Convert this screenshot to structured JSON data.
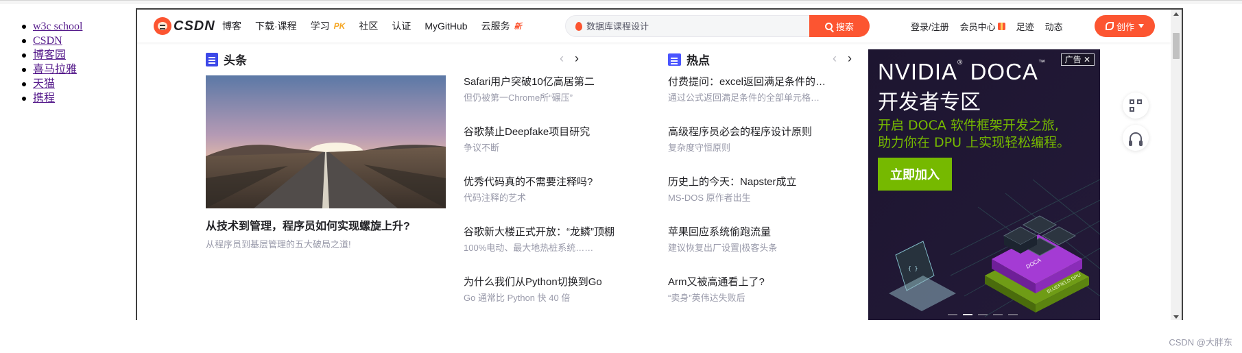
{
  "outer_links": [
    "w3c school",
    "CSDN",
    "博客园",
    "喜马拉雅",
    "天猫",
    "携程"
  ],
  "watermark": "CSDN @大胖东",
  "toolbar": {
    "logo_text": "CSDN",
    "nav": [
      {
        "label": "博客",
        "badge": ""
      },
      {
        "label": "下载·课程",
        "badge": ""
      },
      {
        "label": "学习",
        "badge": "PK"
      },
      {
        "label": "社区",
        "badge": ""
      },
      {
        "label": "认证",
        "badge": ""
      },
      {
        "label": "MyGitHub",
        "badge": ""
      },
      {
        "label": "云服务",
        "badge": "新"
      }
    ],
    "search_placeholder": "数据库课程设计",
    "search_button": "搜索",
    "right": [
      "登录/注册",
      "会员中心",
      "足迹",
      "动态"
    ],
    "create_button": "创作"
  },
  "headline": {
    "section_title": "头条",
    "hero": {
      "title": "从技术到管理，程序员如何实现螺旋上升?",
      "subtitle": "从程序员到基层管理的五大破局之道!"
    },
    "items": [
      {
        "title": "Safari用户突破10亿高居第二",
        "sub": "但仍被第一Chrome所“碾压”"
      },
      {
        "title": "谷歌禁止Deepfake项目研究",
        "sub": "争议不断"
      },
      {
        "title": "优秀代码真的不需要注释吗?",
        "sub": "代码注释的艺术"
      },
      {
        "title": "谷歌新大楼正式开放：“龙鳞”顶棚",
        "sub": "100%电动、最大地热桩系统……"
      },
      {
        "title": "为什么我们从Python切换到Go",
        "sub": "Go 通常比 Python 快 40 倍"
      }
    ]
  },
  "hot": {
    "section_title": "热点",
    "items": [
      {
        "title": "付费提问：excel返回满足条件的…",
        "sub": "通过公式返回满足条件的全部单元格…"
      },
      {
        "title": "高级程序员必会的程序设计原则",
        "sub": "复杂度守恒原则"
      },
      {
        "title": "历史上的今天：Napster成立",
        "sub": "MS-DOS 原作者出生"
      },
      {
        "title": "苹果回应系统偷跑流量",
        "sub": "建议恢复出厂设置|极客头条"
      },
      {
        "title": "Arm又被高通看上了?",
        "sub": "“卖身”英伟达失败后"
      }
    ]
  },
  "ad": {
    "tag": "广告",
    "brand": "NVIDIA",
    "brand_mark": "®",
    "product": "DOCA",
    "product_mark": "™",
    "zone": "开发者专区",
    "line1": "开启 DOCA 软件框架开发之旅,",
    "line2": "助力你在 DPU 上实现轻松编程。",
    "cta": "立即加入",
    "chip_label": "DOCA",
    "board_label": "BLUEFIELD DPU",
    "slides": 5,
    "active_slide": 2,
    "colors": {
      "background": "#1a1526",
      "accent": "#76b900",
      "chip": "#a43bd4"
    }
  },
  "colors": {
    "brand": "#fc5531",
    "link_visited": "#551a8b",
    "text": "#222226",
    "muted": "#999aaa"
  }
}
